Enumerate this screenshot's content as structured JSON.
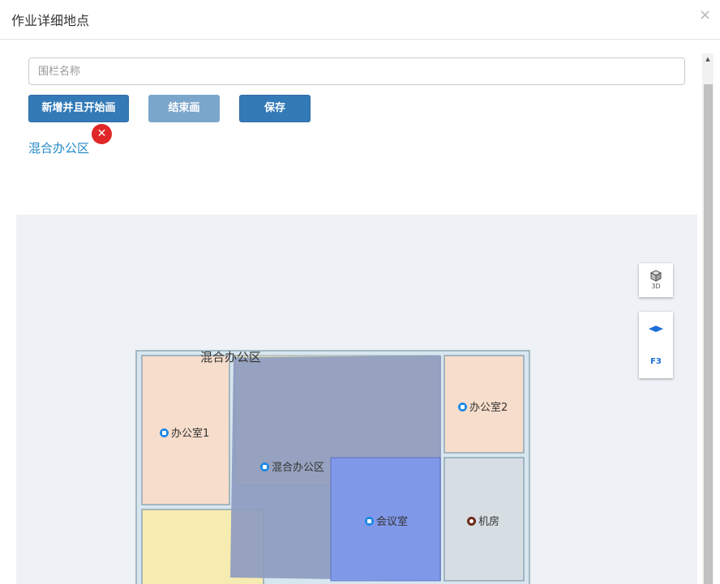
{
  "dialog": {
    "title": "作业详细地点",
    "close_glyph": "×"
  },
  "form": {
    "fence_name_placeholder": "围栏名称",
    "fence_name_value": "",
    "buttons": {
      "add_and_draw": "新增并且开始画",
      "end_draw": "结束画",
      "save": "保存"
    },
    "fence_list": [
      {
        "name": "混合办公区",
        "remove_glyph": "✕"
      }
    ]
  },
  "map": {
    "fence_area_label": "混合办公区",
    "rooms": [
      {
        "name": "办公室1",
        "icon": "office-icon"
      },
      {
        "name": "办公室2",
        "icon": "office-icon"
      },
      {
        "name": "混合办公区",
        "icon": "office-icon"
      },
      {
        "name": "会议室",
        "icon": "meeting-icon"
      },
      {
        "name": "机房",
        "icon": "server-room-icon"
      }
    ],
    "controls": {
      "view_mode": "3D",
      "floor": "F3"
    },
    "colors": {
      "office_fill": "#f7ddcb",
      "yellow_fill": "#f6ebb0",
      "server_fill": "#d6dee3",
      "fence_fill": "#8d9bc0",
      "meeting_fill": "#7f98ec",
      "building_fill": "#d7e6ef"
    }
  }
}
